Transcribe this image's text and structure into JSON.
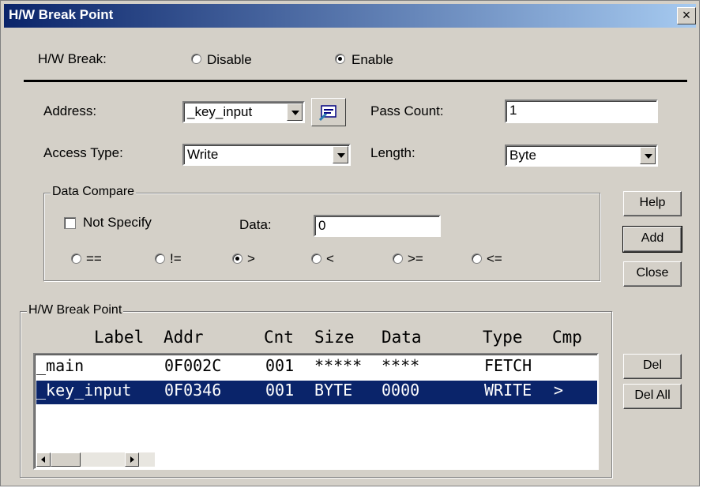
{
  "window": {
    "title": "H/W Break Point",
    "close_glyph": "×"
  },
  "hw_break": {
    "label": "H/W Break:",
    "options": [
      {
        "label": "Disable",
        "selected": false
      },
      {
        "label": "Enable",
        "selected": true
      }
    ]
  },
  "address": {
    "label": "Address:",
    "value": "_key_input",
    "browse_icon": "browse-icon"
  },
  "pass_count": {
    "label": "Pass Count:",
    "value": "1"
  },
  "access_type": {
    "label": "Access Type:",
    "value": "Write"
  },
  "length": {
    "label": "Length:",
    "value": "Byte"
  },
  "data_compare": {
    "title": "Data Compare",
    "not_specify": {
      "label": "Not Specify",
      "checked": false
    },
    "data": {
      "label": "Data:",
      "value": "0"
    },
    "operators": [
      {
        "label": "==",
        "selected": false
      },
      {
        "label": "!=",
        "selected": false
      },
      {
        "label": ">",
        "selected": true
      },
      {
        "label": "<",
        "selected": false
      },
      {
        "label": ">=",
        "selected": false
      },
      {
        "label": "<=",
        "selected": false
      }
    ]
  },
  "side_buttons": {
    "help": "Help",
    "add": "Add",
    "close": "Close",
    "del": "Del",
    "del_all": "Del All"
  },
  "break_points": {
    "title": "H/W Break Point",
    "columns": [
      "Label",
      "Addr",
      "Cnt",
      "Size",
      "Data",
      "Type",
      "Cmp"
    ],
    "rows": [
      {
        "label": "_main",
        "addr": "0F002C",
        "cnt": "001",
        "size": "*****",
        "data": "****",
        "type": "FETCH",
        "cmp": "",
        "selected": false
      },
      {
        "label": "_key_input",
        "addr": "0F0346",
        "cnt": "001",
        "size": "BYTE",
        "data": "0000",
        "type": "WRITE",
        "cmp": ">",
        "selected": true
      }
    ]
  },
  "colors": {
    "face": "#d4d0c8",
    "title_start": "#0a246a",
    "title_end": "#a6caf0",
    "selection": "#0a246a"
  }
}
